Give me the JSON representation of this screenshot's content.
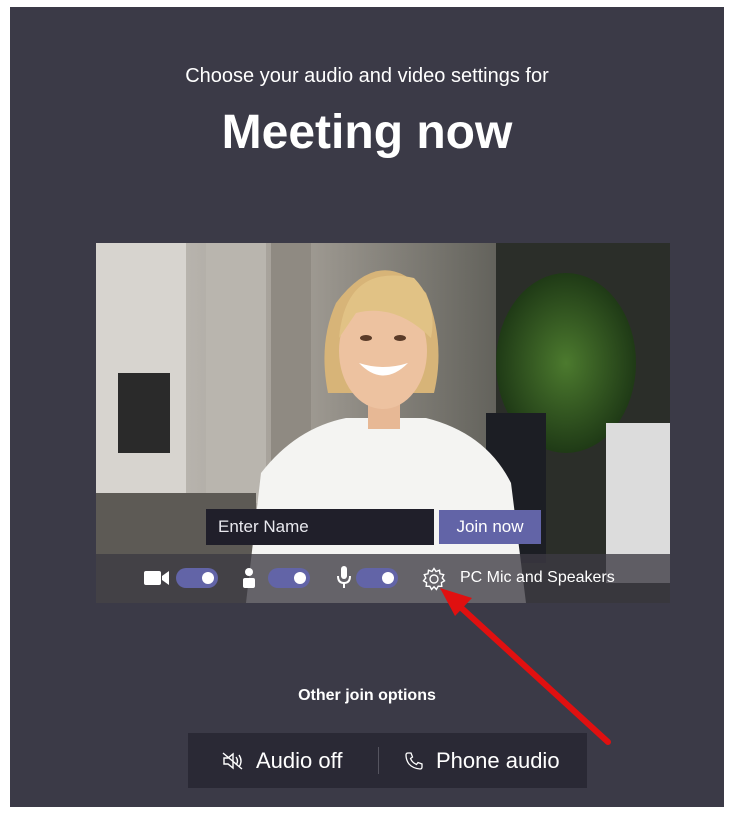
{
  "header": {
    "subtitle": "Choose your audio and video settings for",
    "meeting_title": "Meeting now"
  },
  "preview": {
    "name_placeholder": "Enter Name",
    "join_label": "Join now",
    "camera_toggle": "on",
    "background_toggle": "on",
    "mic_toggle": "on",
    "device_label": "PC Mic and Speakers"
  },
  "other_options": {
    "heading": "Other join options",
    "audio_off_label": "Audio off",
    "phone_audio_label": "Phone audio"
  },
  "colors": {
    "background": "#3b3a47",
    "accent": "#6264a7",
    "annotation_arrow": "#e01010"
  },
  "icons": [
    "video-camera-icon",
    "blur-person-icon",
    "microphone-icon",
    "gear-icon",
    "speaker-muted-icon",
    "phone-icon"
  ]
}
